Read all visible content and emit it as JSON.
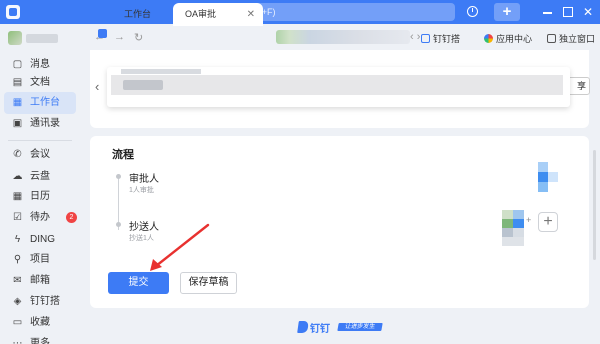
{
  "titlebar": {
    "search_placeholder": "搜索 (Ctrl+Shift+F)",
    "new_button": "+",
    "accent": "#3d7bf5"
  },
  "sidebar": {
    "items": [
      {
        "label": "消息",
        "icon": "chat-icon"
      },
      {
        "label": "文档",
        "icon": "document-icon"
      },
      {
        "label": "工作台",
        "icon": "grid-icon",
        "active": true
      },
      {
        "label": "通讯录",
        "icon": "contacts-icon"
      },
      {
        "label": "会议",
        "icon": "phone-icon"
      },
      {
        "label": "云盘",
        "icon": "cloud-icon"
      },
      {
        "label": "日历",
        "icon": "calendar-icon"
      },
      {
        "label": "待办",
        "icon": "todo-icon",
        "badge": "2"
      },
      {
        "label": "DING",
        "icon": "ding-icon"
      },
      {
        "label": "项目",
        "icon": "project-icon"
      },
      {
        "label": "邮箱",
        "icon": "mail-icon"
      },
      {
        "label": "钉钉搭",
        "icon": "build-icon"
      },
      {
        "label": "收藏",
        "icon": "favorite-icon"
      },
      {
        "label": "更多",
        "icon": "more-icon"
      }
    ]
  },
  "tabs": {
    "items": [
      {
        "label": "工作台"
      },
      {
        "label": "OA审批"
      }
    ],
    "right_links": [
      {
        "label": "钉钉搭"
      },
      {
        "label": "应用中心"
      },
      {
        "label": "独立窗口"
      }
    ],
    "share_label": "享"
  },
  "form": {
    "section_title": "流程",
    "nodes": [
      {
        "title": "审批人",
        "sub": "1人审批"
      },
      {
        "title": "抄送人",
        "sub": "抄送1人"
      }
    ],
    "add_symbol": "+",
    "plus_symbol": "+",
    "submit_label": "提交",
    "draft_label": "保存草稿"
  },
  "footer": {
    "brand": "钉钉",
    "slogan": "让进步发生"
  }
}
